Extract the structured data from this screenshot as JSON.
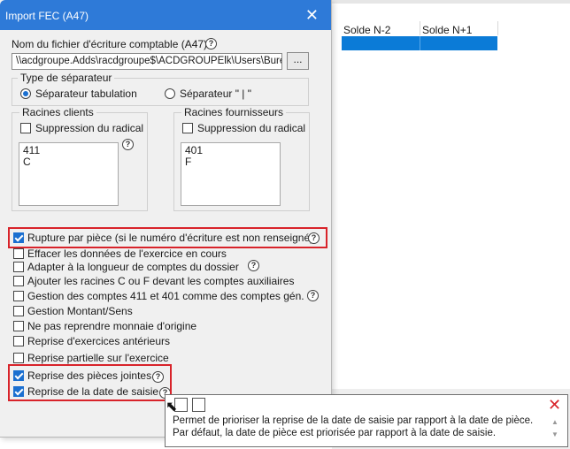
{
  "background": {
    "columns": [
      "Solde N-2",
      "Solde N+1"
    ]
  },
  "dialog": {
    "title": "Import FEC (A47)",
    "file_label": "Nom du fichier d'écriture comptable (A47)",
    "file_value": "\\\\acdgroupe.Adds\\racdgroupe$\\ACDGROUPElk\\Users\\Bureau",
    "browse_label": "...",
    "separator": {
      "legend": "Type de séparateur",
      "options": [
        "Séparateur tabulation",
        "Séparateur \" | \""
      ],
      "selected": 0
    },
    "racines_clients": {
      "legend": "Racines clients",
      "checkbox_label": "Suppression du radical",
      "values": [
        "411",
        "C"
      ]
    },
    "racines_fournisseurs": {
      "legend": "Racines fournisseurs",
      "checkbox_label": "Suppression du radical",
      "values": [
        "401",
        "F"
      ]
    },
    "options": [
      {
        "label": "Rupture par pièce (si le numéro d'écriture est non renseigné)",
        "checked": true,
        "help": true
      },
      {
        "label": "Effacer les données de l'exercice en cours",
        "checked": false,
        "help": false
      },
      {
        "label": "Adapter à la longueur de comptes du dossier",
        "checked": false,
        "help": true
      },
      {
        "label": "Ajouter les racines C ou F devant les comptes auxiliaires",
        "checked": false,
        "help": false
      },
      {
        "label": "Gestion des comptes 411 et 401 comme des comptes gén.",
        "checked": false,
        "help": true
      },
      {
        "label": "Gestion Montant/Sens",
        "checked": false,
        "help": false
      },
      {
        "label": "Ne pas reprendre monnaie d'origine",
        "checked": false,
        "help": false
      },
      {
        "label": "Reprise d'exercices antérieurs",
        "checked": false,
        "help": false
      },
      {
        "label": "Reprise partielle sur l'exercice",
        "checked": false,
        "help": false
      },
      {
        "label": "Reprise des pièces jointes",
        "checked": true,
        "help": true
      },
      {
        "label": "Reprise de la date de saisie",
        "checked": true,
        "help": true
      }
    ]
  },
  "tooltip": {
    "line1": "Permet de prioriser la reprise de la date de saisie par rapport à la date de pièce.",
    "line2": "Par défaut, la date de pièce est priorisée par rapport à la date de saisie.",
    "close_icon": "close-icon",
    "accent": "#d8232a"
  },
  "colors": {
    "titlebar": "#2e7ad8",
    "selected_row": "#0b7bd7",
    "checkbox_on": "#1a6fd0",
    "highlight_box": "#d8232a"
  }
}
